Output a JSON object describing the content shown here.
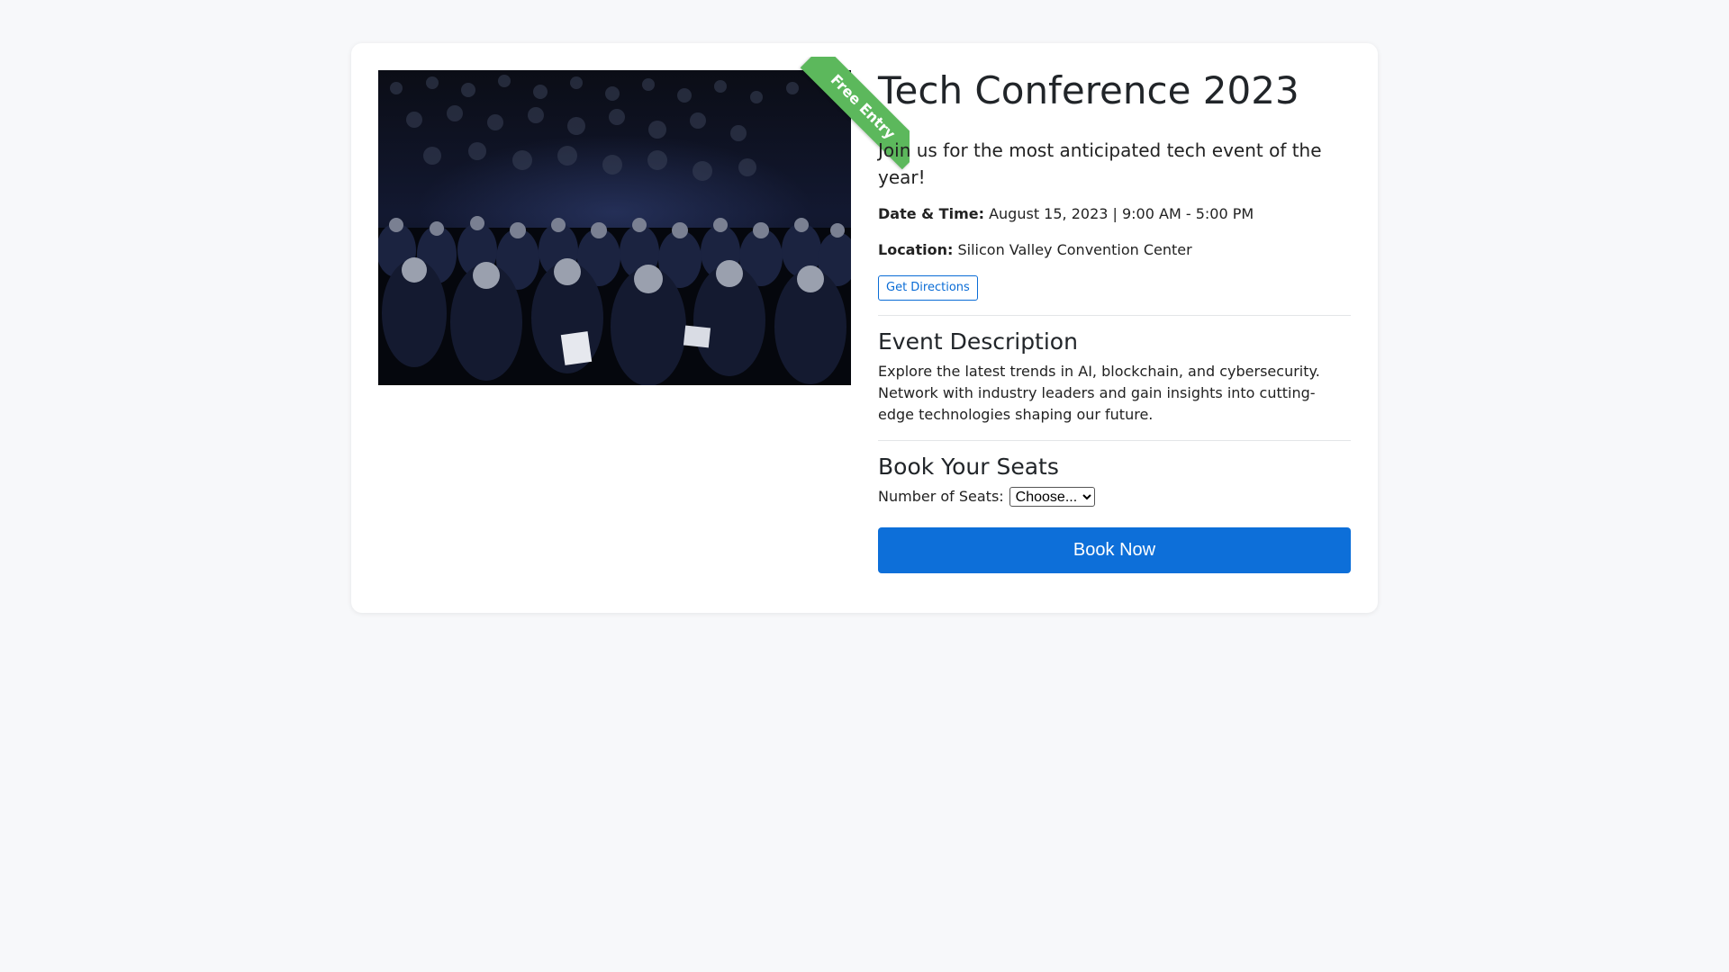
{
  "event": {
    "image_alt": "Conference audience seated in a dark auditorium",
    "ribbon": "Free Entry",
    "title": "Tech Conference 2023",
    "tagline": "Join us for the most anticipated tech event of the year!",
    "date_label": "Date & Time:",
    "date_value": "August 15, 2023 | 9:00 AM - 5:00 PM",
    "location_label": "Location:",
    "location_value": "Silicon Valley Convention Center",
    "directions_button": "Get Directions"
  },
  "description": {
    "heading": "Event Description",
    "text": "Explore the latest trends in AI, blockchain, and cybersecurity. Network with industry leaders and gain insights into cutting-edge technologies shaping our future."
  },
  "booking": {
    "heading": "Book Your Seats",
    "seats_label": "Number of Seats:",
    "seats_selected": "Choose...",
    "book_button": "Book Now"
  },
  "colors": {
    "ribbon": "#5cb85c",
    "primary": "#0d6fd9",
    "background": "#f7f8fa"
  }
}
